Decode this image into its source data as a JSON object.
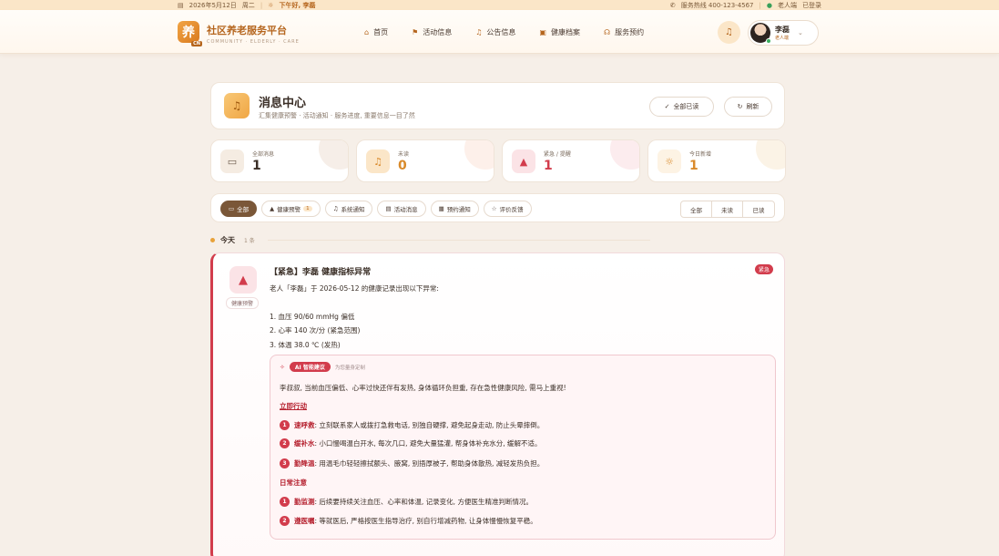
{
  "topbar": {
    "date": "2026年5月12日",
    "weekday": "周二",
    "greeting": "下午好, 李磊",
    "hotline": "服务热线 400-123-4567",
    "role": "老人端",
    "status": "已登录"
  },
  "brand": {
    "logo_char": "养",
    "logo_badge": "CN",
    "title": "社区养老服务平台",
    "subtitle": "COMMUNITY · ELDERLY · CARE"
  },
  "nav": [
    {
      "label": "首页",
      "icon": "home-icon",
      "glyph": "⌂"
    },
    {
      "label": "活动信息",
      "icon": "flag-icon",
      "glyph": "⚑"
    },
    {
      "label": "公告信息",
      "icon": "bell-icon",
      "glyph": "♫"
    },
    {
      "label": "健康档案",
      "icon": "folder-icon",
      "glyph": "▣"
    },
    {
      "label": "服务预约",
      "icon": "headset-icon",
      "glyph": "☊"
    }
  ],
  "user": {
    "name": "李磊",
    "role": "老人端"
  },
  "page": {
    "title": "消息中心",
    "subtitle": "汇集健康预警 · 活动通知 · 服务进度, 重要信息一目了然",
    "mark_all_read": "全部已读",
    "refresh": "刷新"
  },
  "stats": [
    {
      "label": "全部消息",
      "value": "1",
      "icon": "inbox-icon",
      "color": "#6b5a4a",
      "bg": "#f5ece2"
    },
    {
      "label": "未读",
      "value": "0",
      "icon": "bell-icon",
      "color": "#d98a2b",
      "bg": "#fbe6c8"
    },
    {
      "label": "紧急 / 提醒",
      "value": "1",
      "icon": "warning-icon",
      "color": "#d23c4c",
      "bg": "#fbe3e6"
    },
    {
      "label": "今日新增",
      "value": "1",
      "icon": "sun-icon",
      "color": "#d98a2b",
      "bg": "#fdf3e4"
    }
  ],
  "filters": [
    {
      "label": "全部",
      "icon": "inbox-icon",
      "glyph": "▭",
      "active": true
    },
    {
      "label": "健康预警",
      "icon": "warning-icon",
      "glyph": "▲",
      "count": "1"
    },
    {
      "label": "系统通知",
      "icon": "bell-icon",
      "glyph": "♫"
    },
    {
      "label": "活动消息",
      "icon": "calendar-icon",
      "glyph": "▤"
    },
    {
      "label": "预约通知",
      "icon": "clipboard-icon",
      "glyph": "▦"
    },
    {
      "label": "评价反馈",
      "icon": "star-icon",
      "glyph": "☆"
    }
  ],
  "read_filter": [
    "全部",
    "未读",
    "已读"
  ],
  "group": {
    "label": "今天",
    "count": "1 条"
  },
  "message": {
    "category": "健康预警",
    "title": "【紧急】李磊 健康指标异常",
    "tag": "紧急",
    "intro": "老人「李磊」于 2026-05-12 的健康记录出现以下异常:",
    "items": [
      "1. 血压 90/60 mmHg 偏低",
      "2. 心率 140 次/分 (紧急范围)",
      "3. 体温 38.0 ℃ (发热)"
    ],
    "ai": {
      "badge": "AI 智能建议",
      "hint": "为您量身定制",
      "summary": "李叔叔, 当前血压偏低、心率过快还伴有发热, 身体循环负担重, 存在急性健康风险, 需马上重视!",
      "section1": "立即行动",
      "actions": [
        {
          "n": "1",
          "kw": "速呼救",
          "text": ": 立刻联系家人或拨打急救电话, 别独自硬撑, 避免起身走动, 防止头晕摔倒。"
        },
        {
          "n": "2",
          "kw": "缓补水",
          "text": ": 小口慢喝温白开水, 每次几口, 避免大量猛灌, 帮身体补充水分, 缓解不适。"
        },
        {
          "n": "3",
          "kw": "勤降温",
          "text": ": 用温毛巾轻轻擦拭额头、腋窝, 别捂厚被子, 帮助身体散热, 减轻发热负担。"
        }
      ],
      "section2": "日常注意",
      "daily": [
        {
          "n": "1",
          "kw": "勤监测",
          "text": ": 后续要持续关注血压、心率和体温, 记录变化, 方便医生精准判断情况。"
        },
        {
          "n": "2",
          "kw": "遵医嘱",
          "text": ": 等就医后, 严格按医生指导治疗, 别自行增减药物, 让身体慢慢恢复平稳。"
        }
      ]
    }
  }
}
